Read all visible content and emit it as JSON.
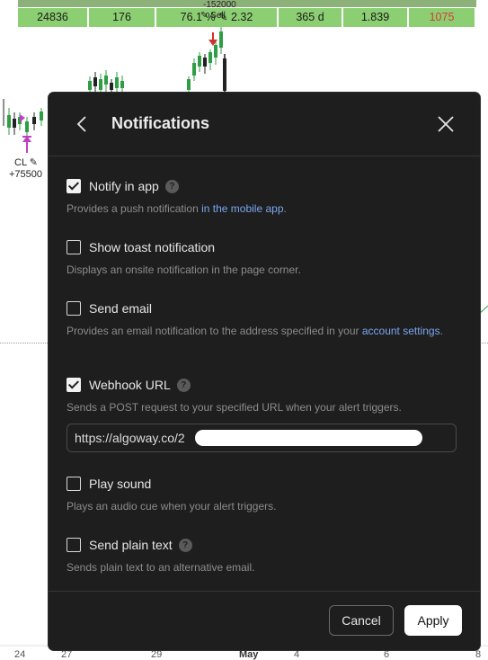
{
  "chart": {
    "stats_values": [
      "24836",
      "176",
      "76.1 % ✎ 2.32",
      "365 d",
      "1.839",
      "1075"
    ],
    "stats_colors": {
      "positive_bg": "#8ccf72",
      "negative_text": "#d83a3a"
    },
    "trade_marker_top": "-152000",
    "trade_marker_sell": "✎ Sell",
    "cl_label": "CL ✎",
    "cl_value": "+75500",
    "x_axis": [
      "24",
      "27",
      "29",
      "May",
      "4",
      "6",
      "8"
    ],
    "candle_colors": {
      "up": "#2e9e44",
      "down": "#222222",
      "marker_buy": "#c040c0",
      "marker_sell": "#d03030"
    }
  },
  "modal": {
    "title": "Notifications",
    "back_icon": "chevron-left-icon",
    "close_icon": "close-icon",
    "options": [
      {
        "label": "Notify in app",
        "checked": true,
        "help": true,
        "desc_pre": "Provides a push notification ",
        "desc_link": "in the mobile app",
        "desc_post": "."
      },
      {
        "label": "Show toast notification",
        "checked": false,
        "help": false,
        "desc": "Displays an onsite notification in the page corner."
      },
      {
        "label": "Send email",
        "checked": false,
        "help": false,
        "desc_pre": "Provides an email notification to the address specified in your ",
        "desc_link": "account settings",
        "desc_post": "."
      },
      {
        "label": "Webhook URL",
        "checked": true,
        "help": true,
        "desc": "Sends a POST request to your specified URL when your alert triggers."
      },
      {
        "label": "Play sound",
        "checked": false,
        "help": false,
        "desc": "Plays an audio cue when your alert triggers."
      },
      {
        "label": "Send plain text",
        "checked": false,
        "help": true,
        "desc": "Sends plain text to an alternative email."
      }
    ],
    "webhook_url_value": "https://algoway.co/2",
    "cancel_label": "Cancel",
    "apply_label": "Apply",
    "colors": {
      "background": "#1e1e1e",
      "link": "#7aa6f0",
      "text": "#e6e6e6",
      "muted": "#8c8c8c"
    }
  }
}
